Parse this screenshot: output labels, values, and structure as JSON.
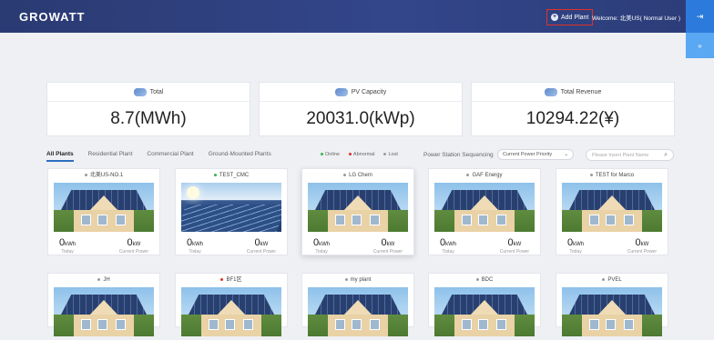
{
  "header": {
    "logo": "GROWATT",
    "add_plant": "Add Plant",
    "welcome": "Welcome: 北美US( Normal User )",
    "exit_icon": "exit-icon",
    "side_icon": "expand-icon"
  },
  "stats": [
    {
      "label": "Total",
      "value": "8.7(MWh)"
    },
    {
      "label": "PV Capacity",
      "value": "20031.0(kWp)"
    },
    {
      "label": "Total Revenue",
      "value": "10294.22(¥)"
    }
  ],
  "tabs": [
    "All Plants",
    "Residential Plant",
    "Commercial Plant",
    "Ground-Mounted Plants"
  ],
  "legend": [
    {
      "label": "Online",
      "color": "#35b54a"
    },
    {
      "label": "Abnormal",
      "color": "#e0302a"
    },
    {
      "label": "Lost",
      "color": "#9a9a9a"
    }
  ],
  "sequencing": {
    "label": "Power Station Sequencing",
    "selected": "Current Power Priority"
  },
  "search": {
    "placeholder": "Please Insert Plant Name"
  },
  "plants_row1": [
    {
      "name": "北美US-NO.1",
      "dot": "#9a9a9a",
      "today": "0",
      "power": "0"
    },
    {
      "name": "TEST_CMC",
      "dot": "#35b54a",
      "today": "0",
      "power": "0"
    },
    {
      "name": "LG Chem",
      "dot": "#9a9a9a",
      "today": "0",
      "power": "0"
    },
    {
      "name": "GAF Energy",
      "dot": "#9a9a9a",
      "today": "0",
      "power": "0"
    },
    {
      "name": "TEST for Marco",
      "dot": "#9a9a9a",
      "today": "0",
      "power": "0"
    }
  ],
  "plants_row2": [
    {
      "name": "JH",
      "dot": "#9a9a9a"
    },
    {
      "name": "BF1区",
      "dot": "#e0302a"
    },
    {
      "name": "my plant",
      "dot": "#9a9a9a"
    },
    {
      "name": "BDC",
      "dot": "#9a9a9a"
    },
    {
      "name": "PVEL",
      "dot": "#9a9a9a"
    }
  ],
  "units": {
    "energy": "kWh",
    "power": "kW",
    "today": "Today",
    "current_power": "Current Power"
  }
}
